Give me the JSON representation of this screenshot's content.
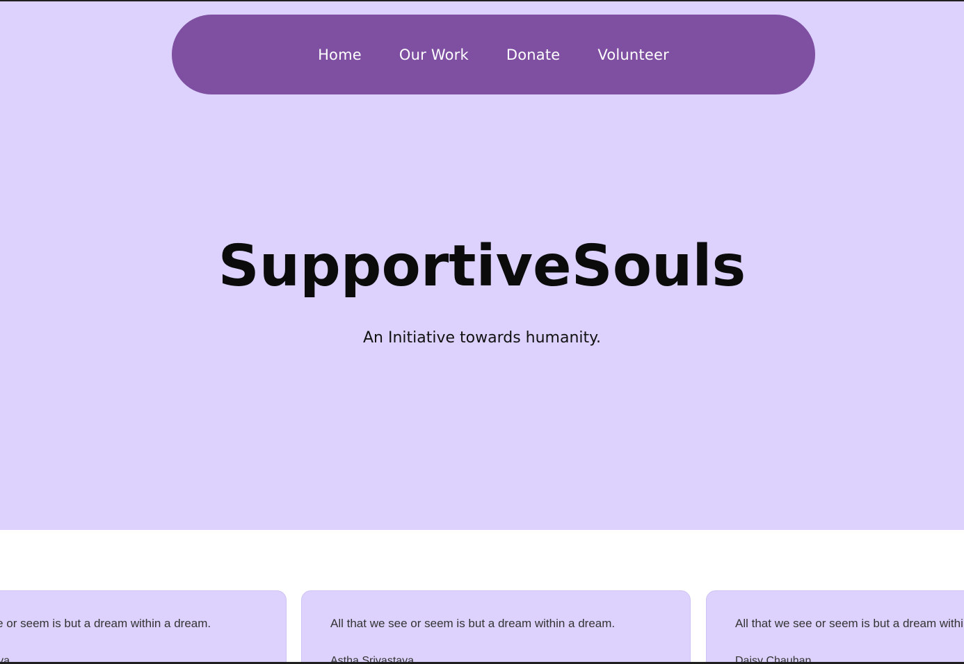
{
  "nav": {
    "links": [
      "Home",
      "Our Work",
      "Donate",
      "Volunteer"
    ]
  },
  "hero": {
    "title": "SupportiveSouls",
    "subtitle": "An Initiative towards humanity."
  },
  "testimonials": [
    {
      "quote": "All that we see or seem is but a dream within a dream.",
      "author": "Astha Srivastava"
    },
    {
      "quote": "All that we see or seem is but a dream within a dream.",
      "author": "Astha Srivastava"
    },
    {
      "quote": "All that we see or seem is but a dream within a dream.",
      "author": "Daisy Chauhan"
    }
  ],
  "colors": {
    "hero_bg": "#dcd2fd",
    "nav_bg": "#7f50a2",
    "card_bg": "#dcd2fd"
  }
}
